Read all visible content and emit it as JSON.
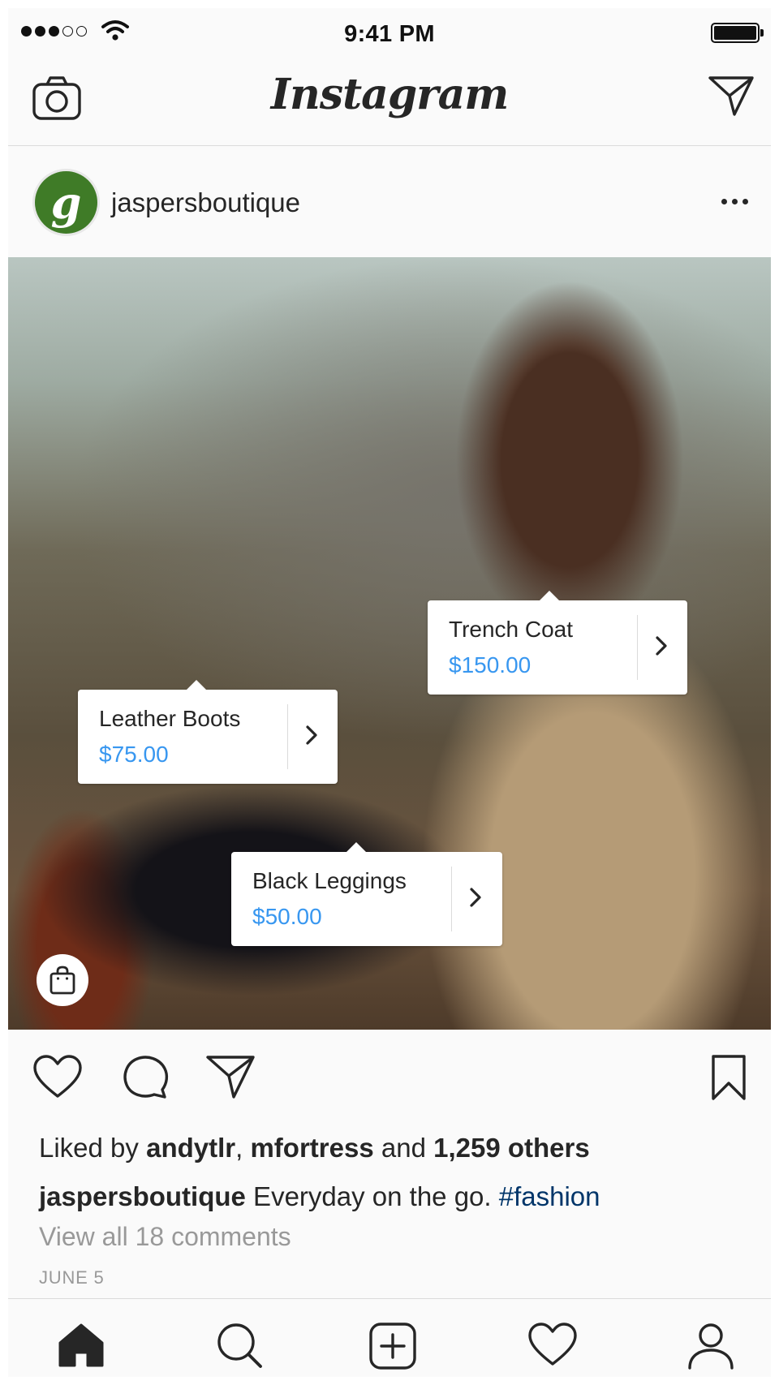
{
  "status_bar": {
    "time": "9:41 PM",
    "signal_icon": "signal-dots-icon",
    "wifi_icon": "wifi-icon",
    "battery_icon": "battery-icon"
  },
  "header": {
    "title": "Instagram",
    "left_icon": "camera-icon",
    "right_icon": "direct-message-icon"
  },
  "post": {
    "username": "jaspersboutique",
    "avatar_letter": "g",
    "avatar_color": "#3f7b27",
    "more_icon": "more-options-icon",
    "product_tags": [
      {
        "name": "Trench Coat",
        "price": "$150.00"
      },
      {
        "name": "Leather Boots",
        "price": "$75.00"
      },
      {
        "name": "Black Leggings",
        "price": "$50.00"
      }
    ],
    "shopping_icon": "shopping-bag-icon",
    "likes": {
      "prefix": "Liked by ",
      "user1": "andytlr",
      "sep": ", ",
      "user2": "mfortress",
      "and": " and ",
      "others": "1,259 others"
    },
    "caption": {
      "username": "jaspersboutique",
      "text": " Everyday on the go. ",
      "hashtag": "#fashion"
    },
    "view_comments": "View all 18 comments",
    "date": "JUNE 5"
  },
  "actions": [
    "like-icon",
    "comment-icon",
    "share-icon",
    "bookmark-icon"
  ],
  "tabbar": [
    "home-icon",
    "search-icon",
    "new-post-icon",
    "activity-icon",
    "profile-icon"
  ],
  "colors": {
    "link_blue": "#3897f0",
    "hashtag_blue": "#003569",
    "text": "#262626",
    "muted": "#999999",
    "border": "#dbdbdb"
  }
}
